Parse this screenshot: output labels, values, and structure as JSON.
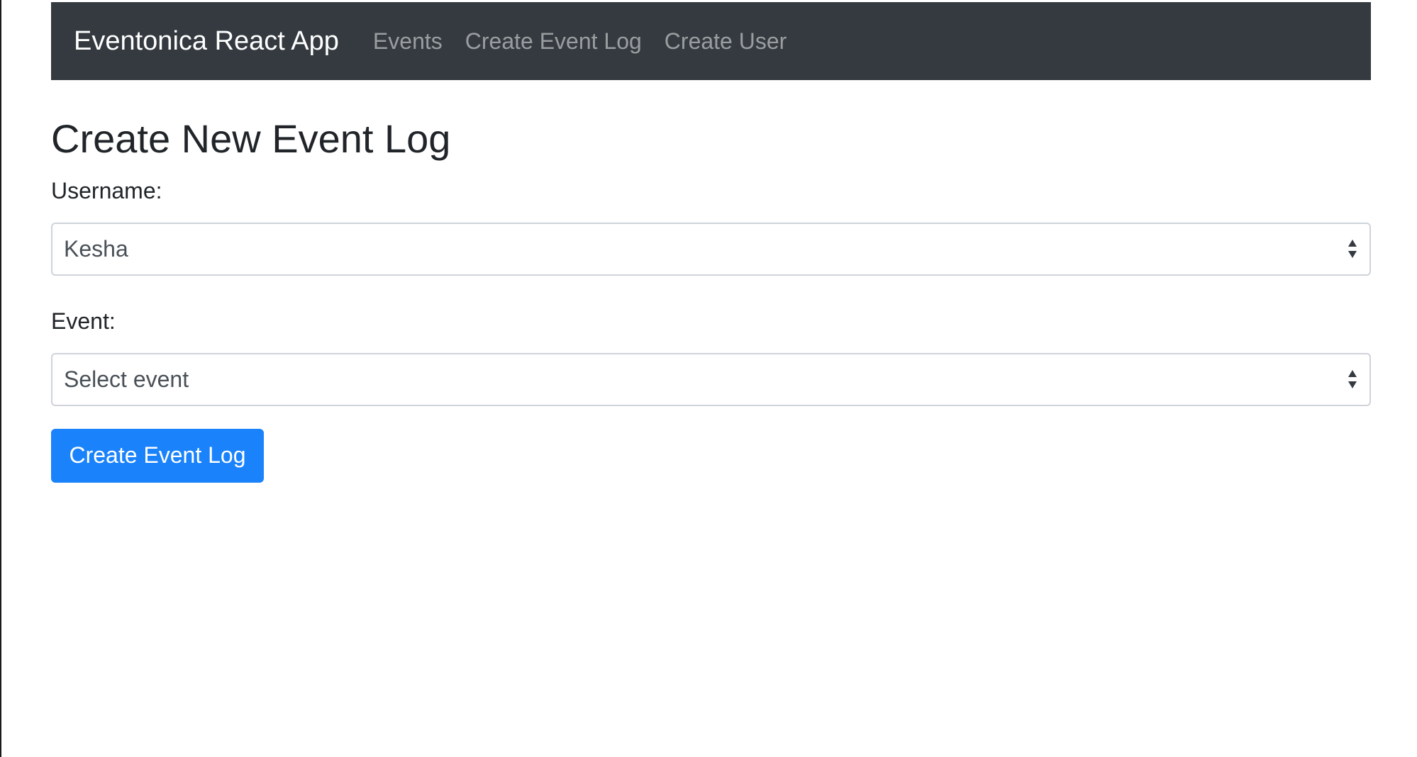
{
  "navbar": {
    "brand": "Eventonica React App",
    "links": [
      {
        "label": "Events"
      },
      {
        "label": "Create Event Log"
      },
      {
        "label": "Create User"
      }
    ]
  },
  "main": {
    "title": "Create New Event Log",
    "username_label": "Username:",
    "username_value": "Kesha",
    "event_label": "Event:",
    "event_value": "Select event",
    "submit_label": "Create Event Log"
  },
  "colors": {
    "navbar_bg": "#343a40",
    "primary": "#1a82fb"
  }
}
